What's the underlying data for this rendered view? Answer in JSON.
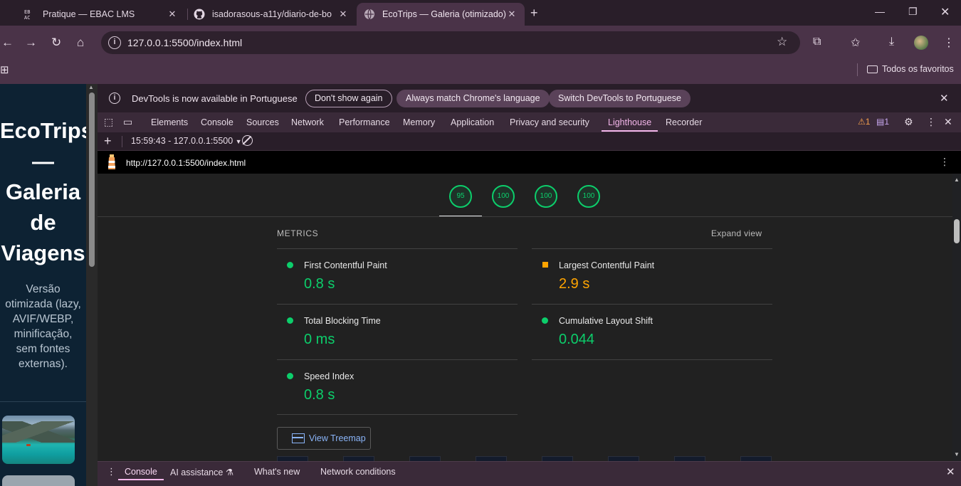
{
  "browser": {
    "tabs": [
      {
        "title": "Pratique — EBAC LMS",
        "favicon": "ebac-logo-icon"
      },
      {
        "title": "isadorasous-a11y/diario-de-bo",
        "favicon": "github-icon"
      },
      {
        "title": "EcoTrips — Galeria (otimizado)",
        "favicon": "globe-icon",
        "active": true
      }
    ],
    "new_tab": "+",
    "address": "127.0.0.1:5500/index.html",
    "bookmarks_all": "Todos os favoritos"
  },
  "page": {
    "title": "EcoTrips — Galeria de Viagens",
    "subtitle": "Versão otimizada (lazy, AVIF/WEBP, minificação, sem fontes externas)."
  },
  "devtools": {
    "infobar": {
      "message": "DevTools is now available in Portuguese",
      "dont_show": "Don't show again",
      "always_match": "Always match Chrome's language",
      "switch": "Switch DevTools to Portuguese"
    },
    "tabs": [
      "Elements",
      "Console",
      "Sources",
      "Network",
      "Performance",
      "Memory",
      "Application",
      "Privacy and security",
      "Lighthouse",
      "Recorder"
    ],
    "active_tab": "Lighthouse",
    "warnings": "1",
    "messages": "1",
    "report_select": "15:59:43 - 127.0.0.1:5500",
    "report_url": "http://127.0.0.1:5500/index.html",
    "scores": [
      "95",
      "100",
      "100",
      "100"
    ],
    "metrics_heading": "METRICS",
    "expand_view": "Expand view",
    "metrics": {
      "fcp": {
        "label": "First Contentful Paint",
        "value": "0.8 s",
        "status": "pass"
      },
      "lcp": {
        "label": "Largest Contentful Paint",
        "value": "2.9 s",
        "status": "average"
      },
      "tbt": {
        "label": "Total Blocking Time",
        "value": "0 ms",
        "status": "pass"
      },
      "cls": {
        "label": "Cumulative Layout Shift",
        "value": "0.044",
        "status": "pass"
      },
      "si": {
        "label": "Speed Index",
        "value": "0.8 s",
        "status": "pass"
      }
    },
    "view_treemap": "View Treemap",
    "drawer": {
      "console": "Console",
      "ai": "AI assistance",
      "whats_new": "What's new",
      "network_conditions": "Network conditions"
    }
  },
  "colors": {
    "pass": "#0cce6b",
    "average": "#ffa400",
    "accent": "#f3b6ea"
  }
}
